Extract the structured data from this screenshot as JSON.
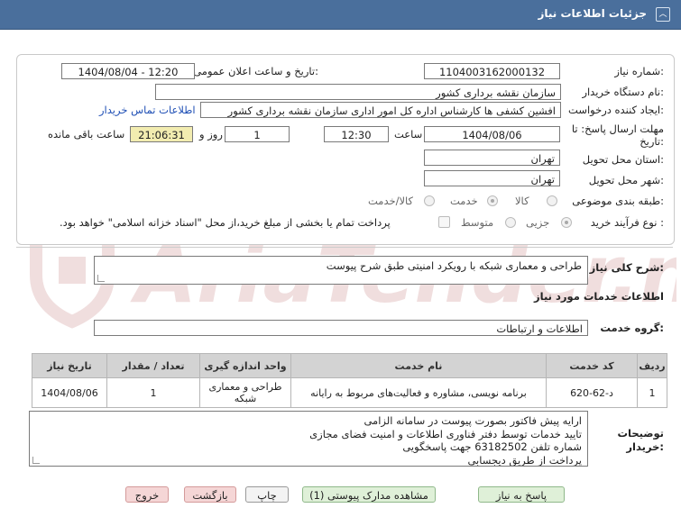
{
  "header": {
    "title": "جزئیات اطلاعات نیاز",
    "collapse_icon": "chevron-up-icon"
  },
  "form": {
    "need_number_label": "شماره نیاز:",
    "need_number": "1104003162000132",
    "announce_label": "تاریخ و ساعت اعلان عمومی:",
    "announce_value": "1404/08/04 - 12:20",
    "buyer_org_label": "نام دستگاه خریدار:",
    "buyer_org": "سازمان نقشه برداری کشور",
    "requester_label": "ایجاد کننده درخواست:",
    "requester": "افشین کشفی ها کارشناس اداره کل امور اداری سازمان نقشه برداری کشور",
    "contact_link": "اطلاعات تماس خریدار",
    "deadline_label": "مهلت ارسال پاسخ: تا تاریخ:",
    "deadline_date": "1404/08/06",
    "time_label": "ساعت",
    "deadline_time": "12:30",
    "days_value": "1",
    "days_label": "روز و",
    "remaining_time": "21:06:31",
    "remaining_label": "ساعت باقی مانده",
    "province_label": "استان محل تحویل:",
    "province": "تهران",
    "city_label": "شهر محل تحویل:",
    "city": "تهران",
    "category_label": "طبقه بندی موضوعی:",
    "category_options": [
      "کالا",
      "خدمت",
      "کالا/خدمت"
    ],
    "category_selected": "خدمت",
    "process_label": "نوع فرآیند خرید :",
    "process_options": [
      "جزیی",
      "متوسط"
    ],
    "process_selected": "جزیی",
    "payment_note": "پرداخت تمام یا بخشی از مبلغ خرید،از محل \"اسناد خزانه اسلامی\" خواهد بود."
  },
  "details": {
    "summary_label": "شرح کلی نیاز:",
    "summary": "طراحی و معماری شبکه با رویکرد امنیتی طبق شرح پیوست",
    "services_title": "اطلاعات خدمات مورد نیاز",
    "group_label": "گروه خدمت:",
    "group_value": "اطلاعات و ارتباطات",
    "table": {
      "headers": [
        "ردیف",
        "کد خدمت",
        "نام خدمت",
        "واحد اندازه گیری",
        "تعداد / مقدار",
        "تاریخ نیاز"
      ],
      "rows": [
        [
          "1",
          "د-62-620",
          "برنامه نویسی، مشاوره و فعالیت‌های مربوط به رایانه",
          "طراحی و معماری شبکه",
          "1",
          "1404/08/06"
        ]
      ]
    },
    "buyer_notes_label": "توضیحات خریدار:",
    "buyer_notes": [
      "ارایه پیش فاکتور بصورت پیوست در سامانه الزامی",
      "تایید خدمات توسط دفتر فناوری اطلاعات و امنیت فضای مجازی",
      "شماره تلفن 63182502  جهت پاسخگویی",
      "پرداخت از طریق دیجسابی"
    ]
  },
  "buttons": {
    "reply": "پاسخ به نیاز",
    "attachments": "مشاهده مدارک پیوستی (1)",
    "print": "چاپ",
    "back": "بازگشت",
    "exit": "خروج"
  },
  "watermark": {
    "text": "AriaTender.net"
  },
  "colors": {
    "header_bg": "#4a6f9c",
    "time_bg": "#f2ecb0",
    "link": "#1f4fb5",
    "green_btn": "#dff0d8",
    "red_btn": "#f5d6d6",
    "watermark": "#f0dede"
  }
}
